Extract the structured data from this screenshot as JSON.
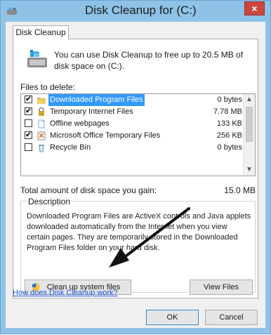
{
  "window": {
    "title": "Disk Cleanup for  (C:)",
    "close_label": "×"
  },
  "tab": {
    "label": "Disk Cleanup"
  },
  "intro": {
    "text": "You can use Disk Cleanup to free up to 20.5 MB of disk space on  (C:)."
  },
  "files": {
    "label": "Files to delete:",
    "rows": [
      {
        "checked": true,
        "name": "Downloaded Program Files",
        "size": "0 bytes",
        "selected": true,
        "icon": "folder-icon"
      },
      {
        "checked": true,
        "name": "Temporary Internet Files",
        "size": "7.78 MB",
        "selected": false,
        "icon": "lock-icon"
      },
      {
        "checked": false,
        "name": "Offline webpages",
        "size": "133 KB",
        "selected": false,
        "icon": "page-icon"
      },
      {
        "checked": true,
        "name": "Microsoft Office Temporary Files",
        "size": "256 KB",
        "selected": false,
        "icon": "office-icon"
      },
      {
        "checked": false,
        "name": "Recycle Bin",
        "size": "0 bytes",
        "selected": false,
        "icon": "recycle-bin-icon"
      }
    ]
  },
  "total": {
    "label": "Total amount of disk space you gain:",
    "value": "15.0 MB"
  },
  "description": {
    "title": "Description",
    "text": "Downloaded Program Files are ActiveX controls and Java applets downloaded automatically from the Internet when you view certain pages. They are temporarily stored in the Downloaded Program Files folder on your hard disk."
  },
  "buttons": {
    "cleanup": "Clean up system files",
    "view_files": "View Files",
    "ok": "OK",
    "cancel": "Cancel"
  },
  "link": {
    "text": "How does Disk Cleanup work?"
  },
  "colors": {
    "title_bar": "#8ec3e7",
    "selection": "#3399ff",
    "close_button": "#c9473f",
    "link": "#1a53d6"
  }
}
